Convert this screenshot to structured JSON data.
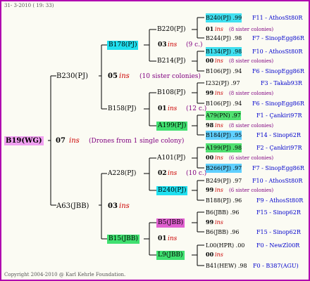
{
  "header": {
    "date_text": "31- 3-2010 ( 19: 33)"
  },
  "footer": {
    "copyright": "Copyright 2004-2010 @ Karl Kehrle Foundation."
  },
  "gen1": {
    "name": "B19(WG)"
  },
  "gen1_num": "07",
  "ins": "ins",
  "gen1_note": "(Drones from 1 single colony)",
  "gen2_top": {
    "name": "B230(PJ)",
    "num": "05",
    "note": "(10 sister colonies)"
  },
  "gen2_bot": {
    "name": "A63(JBB)",
    "num": "03"
  },
  "gen3": [
    {
      "name": "B178(PJ)"
    },
    {
      "name": "B158(PJ)"
    },
    {
      "name": "A228(PJ)"
    },
    {
      "name": "B15(JBB)"
    }
  ],
  "gen3_nums": {
    "b178": "03",
    "b158": "01",
    "a228": "02",
    "b15": "01"
  },
  "gen3_notes": {
    "b178": "(9 c.)",
    "b158": "(12 c.)",
    "a228": "(10 c.)"
  },
  "gen4": [
    {
      "name": "B220(PJ)"
    },
    {
      "name": "B214(PJ)"
    },
    {
      "name": "B108(PJ)"
    },
    {
      "name": "A199(PJ)"
    },
    {
      "name": "A101(PJ)"
    },
    {
      "name": "B240(PJ)"
    },
    {
      "name": "B5(JBB)"
    },
    {
      "name": "L9(JBB)"
    }
  ],
  "gen4_nums": {
    "b220": "01",
    "b214": "00",
    "b108": "99",
    "a199": "98",
    "a101": "00",
    "b240": "99",
    "b5": "99",
    "l9": "00"
  },
  "gen4_notes": {
    "b220": "(8 sister colonies)",
    "b214": "(8 sister colonies)",
    "b108": "(8 sister colonies)",
    "a199": "(8 sister colonies)",
    "a101": "(6 sister colonies)",
    "b240": "(6 sister colonies)"
  },
  "gen5": [
    {
      "name": "B240(PJ) .99",
      "ref": "F11 - AthosSt80R"
    },
    {
      "name": "B244(PJ) .98",
      "ref": "F7 - SinopEgg86R"
    },
    {
      "name": "B134(PJ) .98",
      "ref": "F10 - AthosSt80R"
    },
    {
      "name": "B106(PJ) .94",
      "ref": "F6 - SinopEgg86R"
    },
    {
      "name": "I232(PJ) .97",
      "ref": "F3 - Takab93R"
    },
    {
      "name": "B106(PJ) .94",
      "ref": "F6 - SinopEgg86R"
    },
    {
      "name": "A79(PN) .97",
      "ref": "F1 - Çankiri97R"
    },
    {
      "name": "B184(PJ) .95",
      "ref": "F14 - Sinop62R"
    },
    {
      "name": "A199(PJ) .98",
      "ref": "F2 - Çankiri97R"
    },
    {
      "name": "B266(PJ) .97",
      "ref": "F7 - SinopEgg86R"
    },
    {
      "name": "B249(PJ) .97",
      "ref": "F10 - AthosSt80R"
    },
    {
      "name": "B188(PJ) .96",
      "ref": "F9 - AthosSt80R"
    },
    {
      "name": "B6(JBB) .96",
      "ref": "F15 - Sinop62R"
    },
    {
      "name": "B6(JBB) .96",
      "ref": "F15 - Sinop62R"
    },
    {
      "name": "L00(HPR) .00",
      "ref": "F0 - NewZl00R"
    },
    {
      "name": "B41(HEW) .98",
      "ref": "F0 - B387(AGU)"
    }
  ]
}
